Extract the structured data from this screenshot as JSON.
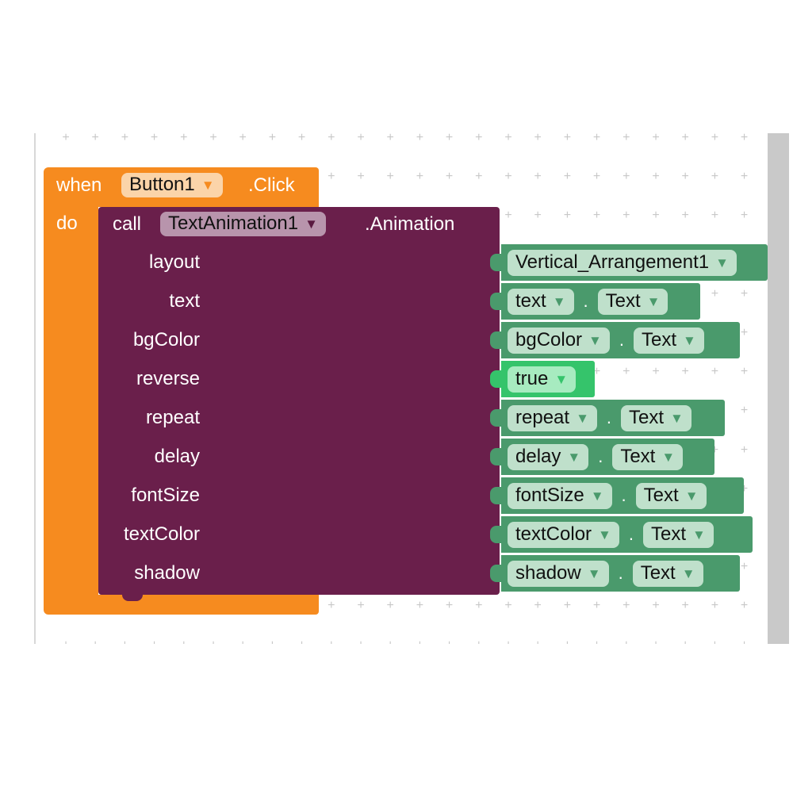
{
  "event_block": {
    "keyword_when": "when",
    "component": "Button1",
    "event": ".Click",
    "keyword_do": "do",
    "color": "#f68b1f"
  },
  "call_block": {
    "keyword_call": "call",
    "component": "TextAnimation1",
    "method": ".Animation",
    "color": "#6a1f4b"
  },
  "params": [
    {
      "label": "layout",
      "value": "Vertical_Arrangement1"
    },
    {
      "label": "text",
      "value": "text",
      "property": "Text"
    },
    {
      "label": "bgColor",
      "value": "bgColor",
      "property": "Text"
    },
    {
      "label": "reverse",
      "value": "true"
    },
    {
      "label": "repeat",
      "value": "repeat",
      "property": "Text"
    },
    {
      "label": "delay",
      "value": "delay",
      "property": "Text"
    },
    {
      "label": "fontSize",
      "value": "fontSize",
      "property": "Text"
    },
    {
      "label": "textColor",
      "value": "textColor",
      "property": "Text"
    },
    {
      "label": "shadow",
      "value": "shadow",
      "property": "Text"
    }
  ],
  "dot": ".",
  "dropdown_icon": "triangle-down",
  "colors": {
    "component_block": "#4a9a6c",
    "logic_block": "#35c46b"
  }
}
